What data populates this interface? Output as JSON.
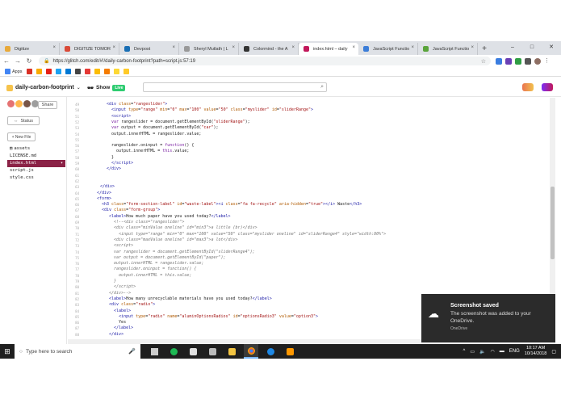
{
  "browser": {
    "tabs": [
      {
        "label": "Digitize",
        "color": "#e8a93a",
        "active": false
      },
      {
        "label": "DIGITIZE TOMOR",
        "color": "#d94a38",
        "active": false
      },
      {
        "label": "Devpost",
        "color": "#1a6fb5",
        "active": false
      },
      {
        "label": "Sheryl Mutlath | L",
        "color": "#999999",
        "active": false
      },
      {
        "label": "Colormind - the A",
        "color": "#333333",
        "active": false
      },
      {
        "label": "index.html – daily",
        "color": "#c2185b",
        "active": true
      },
      {
        "label": "JavaScript Functio",
        "color": "#3b7dd8",
        "active": false
      },
      {
        "label": "JavaScript Functio",
        "color": "#5aa43b",
        "active": false
      }
    ],
    "new_tab": "+",
    "window_controls": [
      "–",
      "□",
      "✕"
    ],
    "url": "https://glitch.com/edit/#!/daily-carbon-footprint?path=script.js:57:19",
    "bookmarks_label": "Apps"
  },
  "glitch": {
    "project_name": "daily-carbon-footprint",
    "show_label": "Show",
    "live_badge": "Live"
  },
  "sidebar": {
    "share_label": "Share",
    "status_label": "Status",
    "new_file_label": "+ New File",
    "files": [
      {
        "name": "assets",
        "selected": false
      },
      {
        "name": "LICENSE.md",
        "selected": false
      },
      {
        "name": "index.html",
        "selected": true
      },
      {
        "name": "script.js",
        "selected": false
      },
      {
        "name": "style.css",
        "selected": false
      }
    ]
  },
  "toast": {
    "title": "Screenshot saved",
    "body": "The screenshot was added to your OneDrive.",
    "source": "OneDrive"
  },
  "taskbar": {
    "search_placeholder": "Type here to search",
    "language": "ENG",
    "time": "10:17 AM",
    "date": "10/14/2018"
  }
}
